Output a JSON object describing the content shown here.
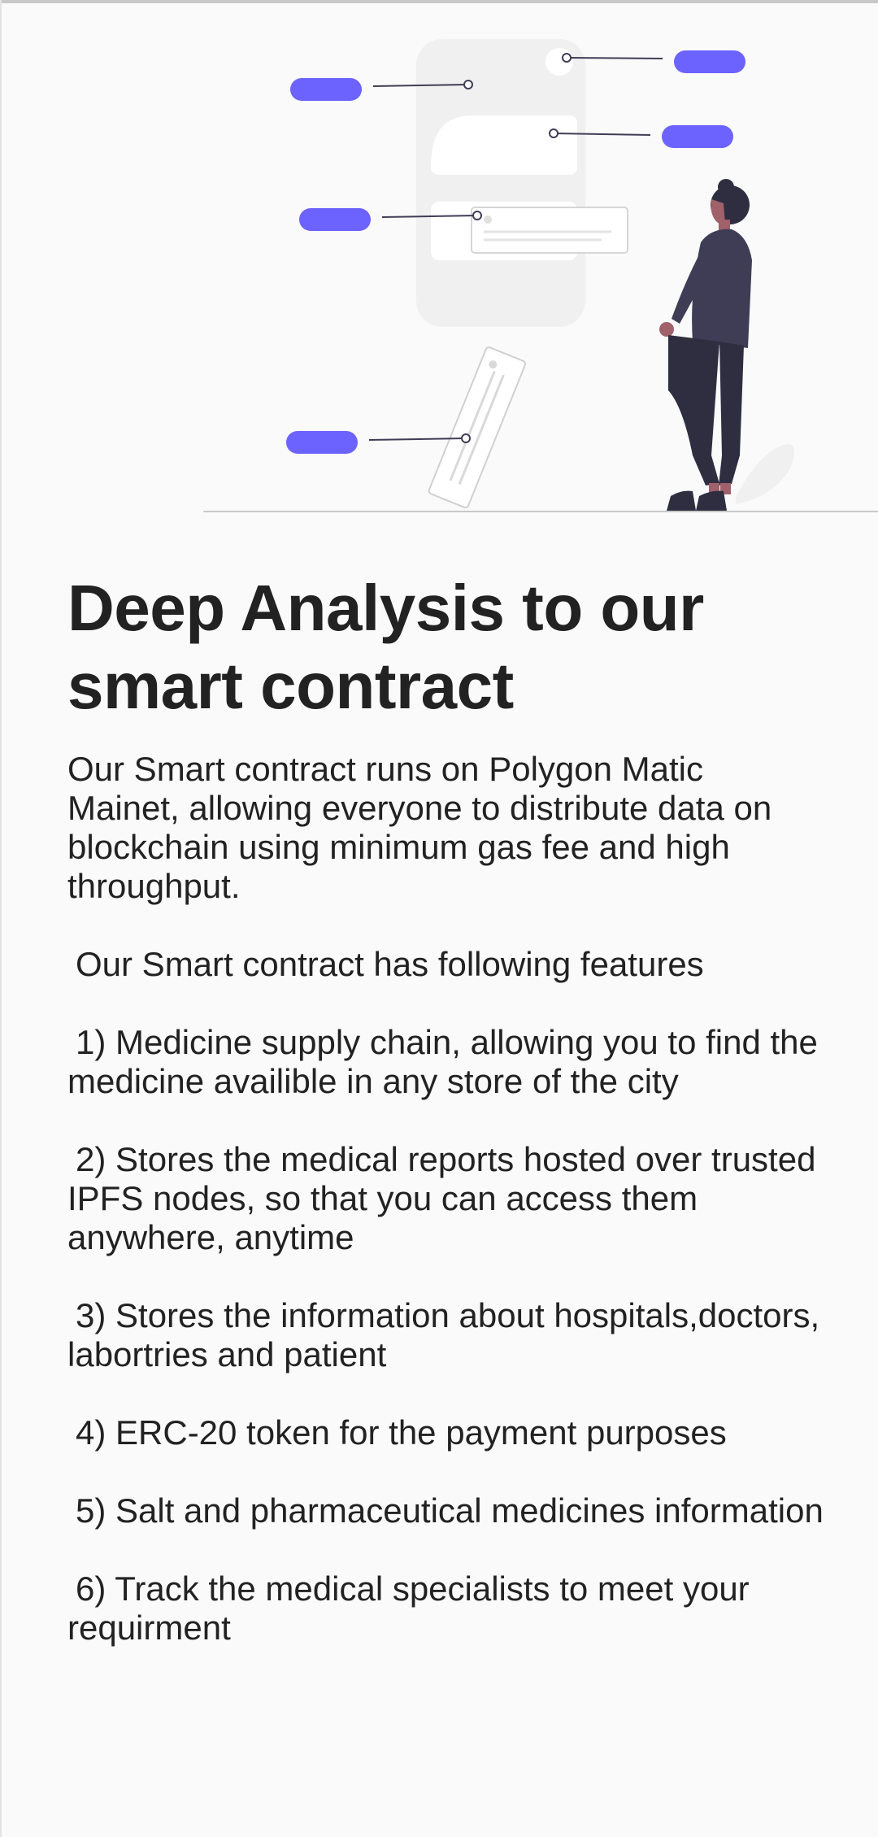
{
  "illustration": {
    "icon": "person-viewing-app-screen-illustration",
    "accent_color": "#6c63ff",
    "figure_color": "#3f3d56",
    "panel_color": "#f0f0f0"
  },
  "article": {
    "title": "Deep Analysis to our smart contract",
    "intro": "Our Smart contract runs on Polygon Matic Mainet, allowing everyone to distribute data on blockchain using minimum gas fee and high throughput.",
    "features_heading": "Our Smart contract has following features",
    "features": [
      "1) Medicine supply chain, allowing you to find the medicine availible in any store of the city",
      "2) Stores the medical reports hosted over trusted IPFS nodes, so that you can access them anywhere, anytime",
      "3) Stores the information about hospitals,doctors, labortries and patient",
      "4) ERC-20 token for the payment purposes",
      "5) Salt and pharmaceutical medicines information",
      "6) Track the medical specialists to meet your requirment"
    ]
  }
}
